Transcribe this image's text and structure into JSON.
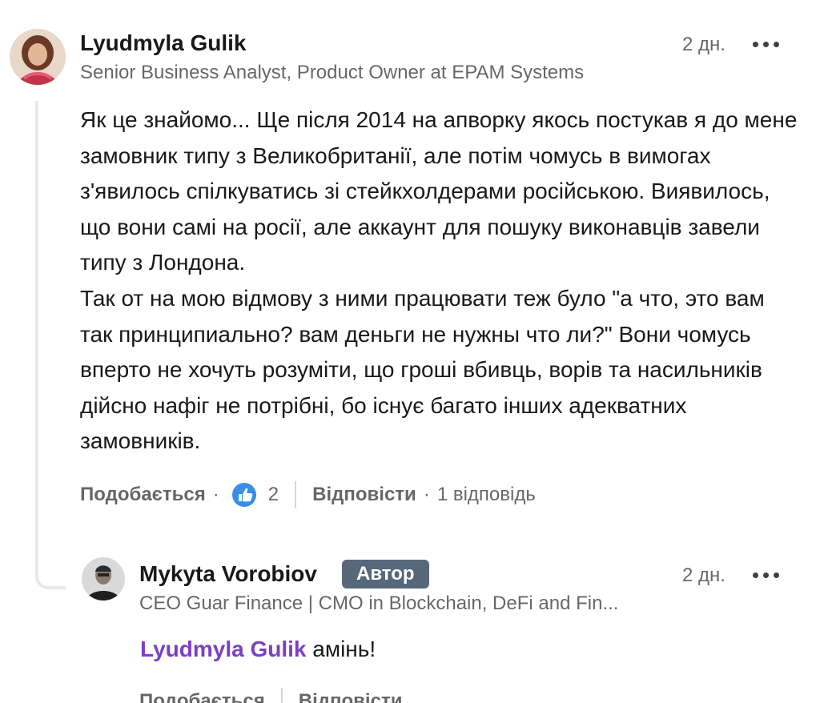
{
  "comment": {
    "author_name": "Lyudmyla Gulik",
    "headline": "Senior Business Analyst, Product Owner at EPAM Systems",
    "time": "2 дн.",
    "paragraphs": [
      "Як це знайомо... Ще після 2014 на апворку якось постукав я до мене замовник типу з Великобританії, але потім чомусь в вимогах з'явилось спілкуватись зі стейкхолдерами російською. Виявилось, що вони самі на росії, але аккаунт для пошуку виконавців завели типу з Лондона.",
      "Так от на мою відмову з ними працювати теж було \"а что, это вам так принципиально? вам деньги не нужны что ли?\" Вони чомусь вперто не хочуть розуміти, що гроші вбивць, ворів та насильників дійсно нафіг не потрібні, бо існує багато інших адекватних замовників."
    ],
    "like_label": "Подобається",
    "like_count": "2",
    "reply_label": "Відповісти",
    "reply_count": "1 відповідь"
  },
  "reply": {
    "author_name": "Mykyta Vorobiov",
    "badge": "Автор",
    "headline": "CEO Guar Finance | CMO in Blockchain, DeFi and Fin...",
    "time": "2 дн.",
    "mention": "Lyudmyla Gulik",
    "text": " амінь!",
    "like_label": "Подобається",
    "reply_label": "Відповісти"
  },
  "icons": {
    "more": "more-horizontal-icon",
    "like": "thumbs-up-reaction-icon"
  },
  "colors": {
    "mention": "#7b3fc4",
    "badge_bg": "#56687a",
    "like_blue": "#378fe9"
  }
}
